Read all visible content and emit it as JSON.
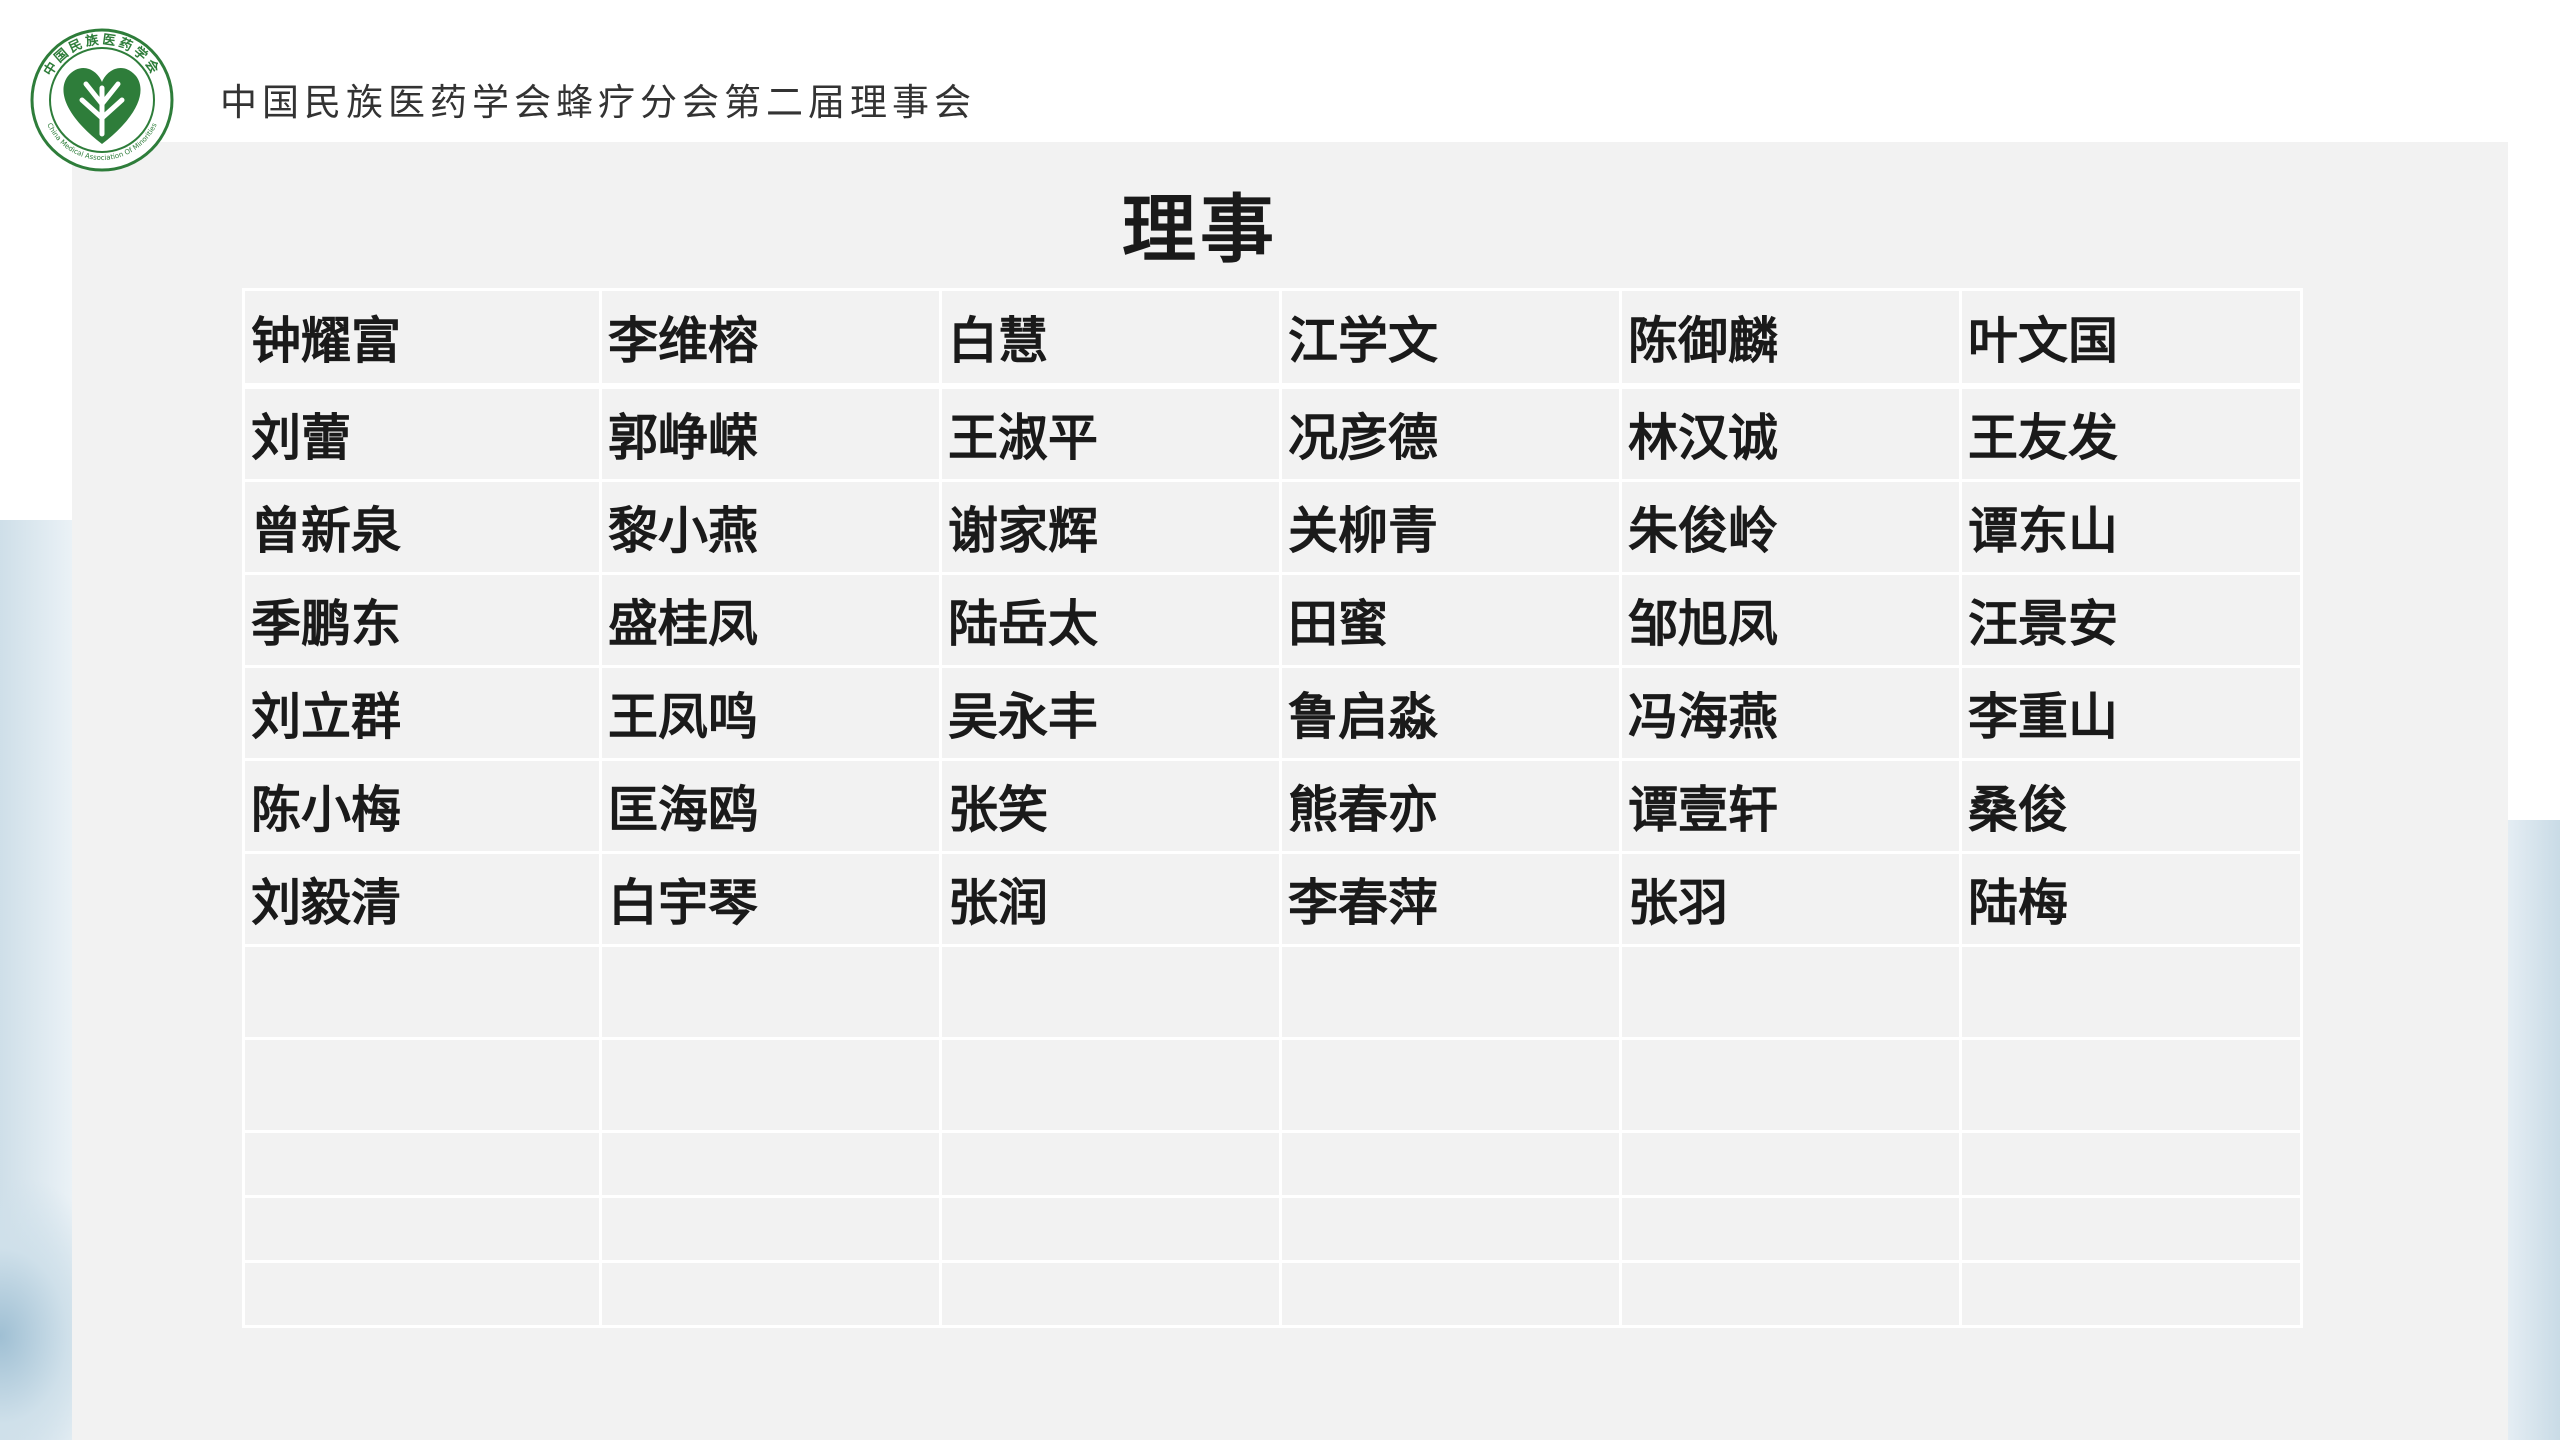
{
  "header": {
    "org_name": "中国民族医药学会蜂疗分会第二届理事会",
    "logo": {
      "icon": "heart-leaf-logo-icon",
      "ring_text_cn": "中国民族医药学会",
      "ring_text_en": "China Medical Association Of Minorities",
      "color": "#2e7d3a"
    }
  },
  "title": "理事",
  "members": [
    [
      "钟耀富",
      "李维榕",
      "白慧",
      "江学文",
      "陈御麟",
      "叶文国"
    ],
    [
      "刘蕾",
      "郭峥嵘",
      "王淑平",
      "况彦德",
      "林汉诚",
      "王友发"
    ],
    [
      "曾新泉",
      "黎小燕",
      "谢家辉",
      "关柳青",
      "朱俊岭",
      "谭东山"
    ],
    [
      "季鹏东",
      "盛桂凤",
      "陆岳太",
      "田蜜",
      "邹旭凤",
      "汪景安"
    ],
    [
      "刘立群",
      "王凤鸣",
      "吴永丰",
      "鲁启淼",
      "冯海燕",
      "李重山"
    ],
    [
      "陈小梅",
      "匡海鸥",
      "张笑",
      "熊春亦",
      "谭壹轩",
      "桑俊"
    ],
    [
      "刘毅清",
      "白宇琴",
      "张润",
      "李春萍",
      "张羽",
      "陆梅"
    ]
  ],
  "colors": {
    "panel": "#f2f2f2",
    "text": "#1a1a1a",
    "grid_lines": "#ffffff",
    "logo_green": "#2e7d3a"
  }
}
